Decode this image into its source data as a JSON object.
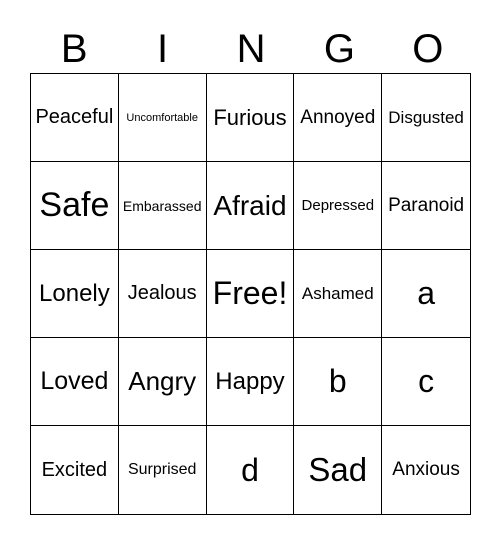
{
  "header": [
    "B",
    "I",
    "N",
    "G",
    "O"
  ],
  "cells": [
    {
      "text": "Peaceful",
      "size": 20
    },
    {
      "text": "Uncomfortable",
      "size": 11
    },
    {
      "text": "Furious",
      "size": 22
    },
    {
      "text": "Annoyed",
      "size": 19
    },
    {
      "text": "Disgusted",
      "size": 17
    },
    {
      "text": "Safe",
      "size": 34
    },
    {
      "text": "Embarassed",
      "size": 14
    },
    {
      "text": "Afraid",
      "size": 28
    },
    {
      "text": "Depressed",
      "size": 15
    },
    {
      "text": "Paranoid",
      "size": 19
    },
    {
      "text": "Lonely",
      "size": 24
    },
    {
      "text": "Jealous",
      "size": 20
    },
    {
      "text": "Free!",
      "size": 32
    },
    {
      "text": "Ashamed",
      "size": 17
    },
    {
      "text": "a",
      "size": 32
    },
    {
      "text": "Loved",
      "size": 25
    },
    {
      "text": "Angry",
      "size": 26
    },
    {
      "text": "Happy",
      "size": 24
    },
    {
      "text": "b",
      "size": 32
    },
    {
      "text": "c",
      "size": 32
    },
    {
      "text": "Excited",
      "size": 20
    },
    {
      "text": "Surprised",
      "size": 16
    },
    {
      "text": "d",
      "size": 32
    },
    {
      "text": "Sad",
      "size": 33
    },
    {
      "text": "Anxious",
      "size": 19
    }
  ]
}
